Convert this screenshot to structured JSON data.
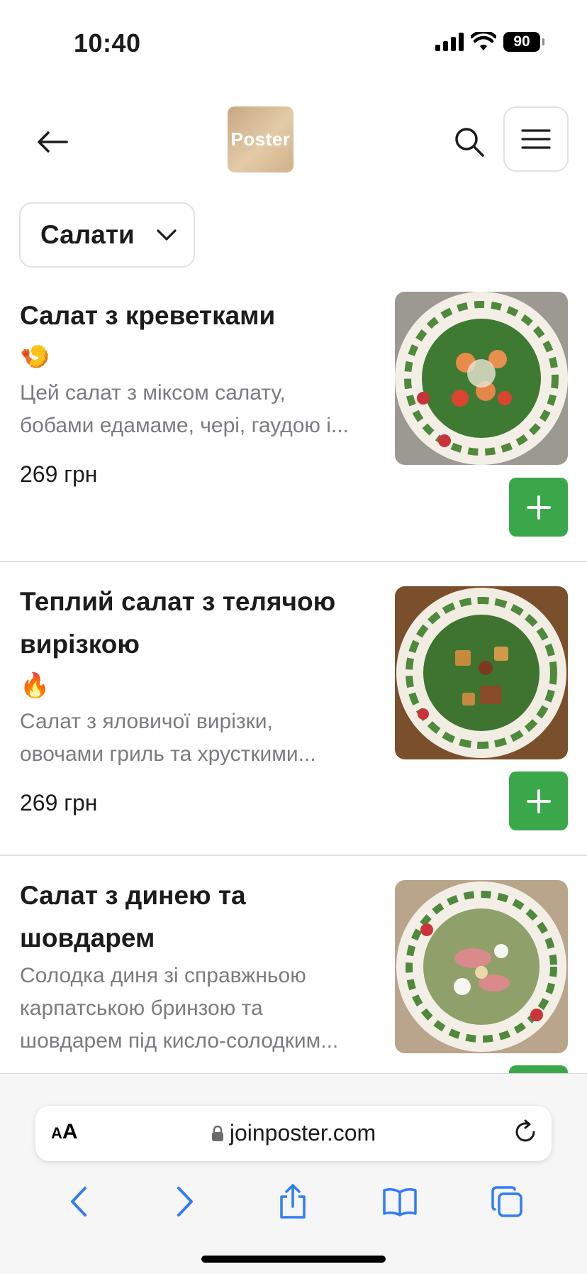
{
  "status_bar": {
    "time": "10:40",
    "battery": "90"
  },
  "header": {
    "logo_text": "Poster",
    "back_icon": "arrow-left-icon",
    "search_icon": "search-icon",
    "menu_icon": "hamburger-menu-icon"
  },
  "category": {
    "label": "Салати",
    "icon": "chevron-down-icon"
  },
  "products": [
    {
      "name": "Салат з креветками",
      "emoji": "🍤",
      "description_line1": "Цей салат з міксом салату,",
      "description_line2": "бобами едамаме, черi, гаудою і...",
      "price": "269 грн"
    },
    {
      "name_line1": "Теплий салат з телячою",
      "name_line2": "вирізкою",
      "emoji": "🔥",
      "description_line1": "Салат з яловичої вирізки,",
      "description_line2": "овочами гриль та хрусткими...",
      "price": "269 грн"
    },
    {
      "name_line1": "Салат з динею та",
      "name_line2": "шовдарем",
      "description_line1": "Солодка диня зі справжньою",
      "description_line2": "карпатською бринзою та",
      "description_line3": "шовдарем під кисло-солодким..."
    }
  ],
  "browser": {
    "text_size_label_small": "A",
    "text_size_label_large": "A",
    "url": "joinposter.com"
  },
  "colors": {
    "accent_green": "#3aa84a",
    "link_blue": "#2f7cf6"
  }
}
